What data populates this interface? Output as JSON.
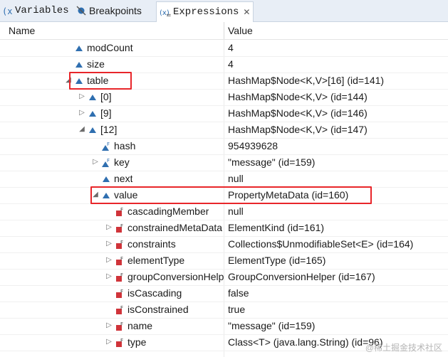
{
  "tabs": [
    {
      "label": "Variables",
      "icon": "variables-icon",
      "active": false
    },
    {
      "label": "Breakpoints",
      "icon": "breakpoints-icon",
      "active": false
    },
    {
      "label": "Expressions",
      "icon": "expressions-icon",
      "active": true
    }
  ],
  "columns": {
    "name": "Name",
    "value": "Value"
  },
  "rows": [
    {
      "name": "modCount",
      "value": "4",
      "icon": "public-field-icon",
      "exp": ""
    },
    {
      "name": "size",
      "value": "4",
      "icon": "public-field-icon",
      "exp": ""
    },
    {
      "name": "table",
      "value": "HashMap$Node<K,V>[16]  (id=141)",
      "icon": "public-field-icon",
      "exp": "expanded",
      "highlight": true
    },
    {
      "name": "[0]",
      "value": "HashMap$Node<K,V>  (id=144)",
      "icon": "public-field-icon",
      "exp": "collapsed"
    },
    {
      "name": "[9]",
      "value": "HashMap$Node<K,V>  (id=146)",
      "icon": "public-field-icon",
      "exp": "collapsed"
    },
    {
      "name": "[12]",
      "value": "HashMap$Node<K,V>  (id=147)",
      "icon": "public-field-icon",
      "exp": "expanded"
    },
    {
      "name": "hash",
      "value": "954939628",
      "icon": "final-field-icon",
      "exp": ""
    },
    {
      "name": "key",
      "value": "\"message\" (id=159)",
      "icon": "final-field-icon",
      "exp": "collapsed"
    },
    {
      "name": "next",
      "value": "null",
      "icon": "public-field-icon",
      "exp": ""
    },
    {
      "name": "value",
      "value": "PropertyMetaData  (id=160)",
      "icon": "public-field-icon",
      "exp": "expanded",
      "highlight": true
    },
    {
      "name": "cascadingMember",
      "value": "null",
      "icon": "private-final-field-icon",
      "exp": ""
    },
    {
      "name": "constrainedMetaData",
      "value": "ElementKind  (id=161)",
      "icon": "private-final-field-icon",
      "exp": "collapsed"
    },
    {
      "name": "constraints",
      "value": "Collections$UnmodifiableSet<E>  (id=164)",
      "icon": "private-final-field-icon",
      "exp": "collapsed"
    },
    {
      "name": "elementType",
      "value": "ElementType  (id=165)",
      "icon": "private-final-field-icon",
      "exp": "collapsed"
    },
    {
      "name": "groupConversionHelper",
      "value": "GroupConversionHelper  (id=167)",
      "icon": "private-final-field-icon",
      "exp": "collapsed"
    },
    {
      "name": "isCascading",
      "value": "false",
      "icon": "private-final-field-icon",
      "exp": ""
    },
    {
      "name": "isConstrained",
      "value": "true",
      "icon": "private-final-field-icon",
      "exp": ""
    },
    {
      "name": "name",
      "value": "\"message\" (id=159)",
      "icon": "private-final-field-icon",
      "exp": "collapsed"
    },
    {
      "name": "type",
      "value": "Class<T> (java.lang.String) (id=96)",
      "icon": "private-final-field-icon",
      "exp": "collapsed"
    }
  ],
  "watermark": "@稀土掘金技术社区",
  "colors": {
    "highlight": "#e8262a",
    "public": "#2f6fb0",
    "private": "#d0343a"
  }
}
